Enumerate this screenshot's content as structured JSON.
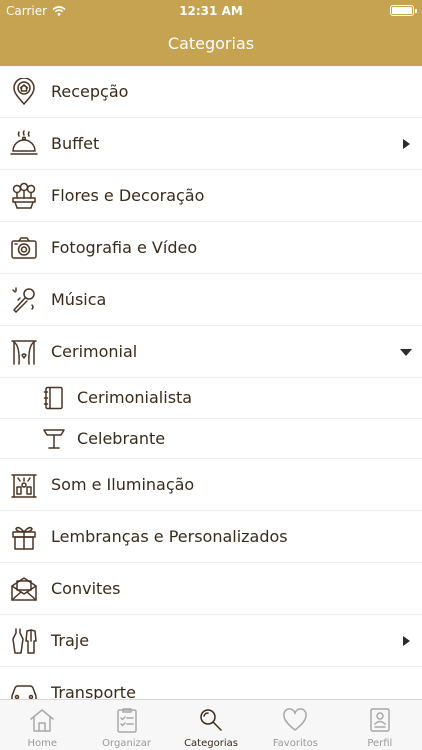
{
  "status_bar": {
    "carrier": "Carrier",
    "time": "12:31 AM"
  },
  "nav": {
    "title": "Categorias"
  },
  "categories": [
    {
      "label": "Recepção",
      "icon": "location-pin-icon"
    },
    {
      "label": "Buffet",
      "icon": "cloche-icon",
      "disclosure": "right"
    },
    {
      "label": "Flores e Decoração",
      "icon": "flowers-icon"
    },
    {
      "label": "Fotografia e Vídeo",
      "icon": "camera-icon"
    },
    {
      "label": "Música",
      "icon": "microphone-icon"
    },
    {
      "label": "Cerimonial",
      "icon": "curtains-icon",
      "disclosure": "down",
      "children": [
        {
          "label": "Cerimonialista",
          "icon": "notebook-icon"
        },
        {
          "label": "Celebrante",
          "icon": "lectern-icon"
        }
      ]
    },
    {
      "label": "Som e Iluminação",
      "icon": "stage-lights-icon"
    },
    {
      "label": "Lembranças e Personalizados",
      "icon": "gift-icon"
    },
    {
      "label": "Convites",
      "icon": "envelope-icon"
    },
    {
      "label": "Traje",
      "icon": "dress-suit-icon",
      "disclosure": "right"
    },
    {
      "label": "Transporte",
      "icon": "car-icon"
    }
  ],
  "tabs": [
    {
      "label": "Home",
      "icon": "home-icon",
      "active": false
    },
    {
      "label": "Organizar",
      "icon": "checklist-icon",
      "active": false
    },
    {
      "label": "Categorias",
      "icon": "magnifier-icon",
      "active": true
    },
    {
      "label": "Favoritos",
      "icon": "heart-icon",
      "active": false
    },
    {
      "label": "Perfil",
      "icon": "profile-card-icon",
      "active": false
    }
  ],
  "colors": {
    "brand": "#c5a351",
    "text": "#3a2a1a",
    "tab_inactive": "#9a9a9a"
  }
}
